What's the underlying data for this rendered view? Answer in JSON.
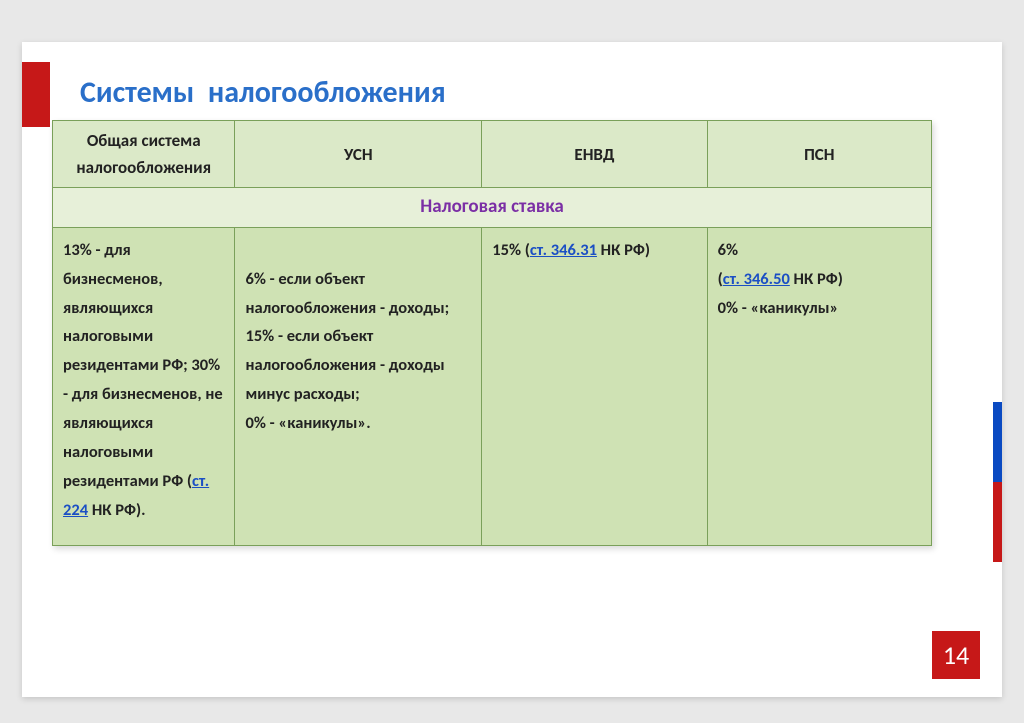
{
  "title": "Системы  налогообложения",
  "headers": [
    "Общая система налогообложения",
    "УСН",
    "ЕНВД",
    "ПСН"
  ],
  "rate_label": "Налоговая ставка",
  "cells": {
    "c0_pre": "13% - для бизнесменов, являющихся налоговыми резидентами РФ; 30% - для бизнесменов, не являющихся налоговыми резидентами РФ (",
    "c0_link": "ст. 224",
    "c0_post": " НК РФ).",
    "c1": "6% - если объект налогообложения - доходы;\n15% - если объект налогообложения - доходы минус расходы;\n0% - «каникулы».",
    "c2_pre": "15% (",
    "c2_link": "ст. 346.31",
    "c2_post": " НК РФ)",
    "c3_line1": "6%",
    "c3_pre": " (",
    "c3_link": "ст. 346.50",
    "c3_post": " НК РФ)",
    "c3_line3": " 0% - «каникулы»"
  },
  "page_number": "14"
}
